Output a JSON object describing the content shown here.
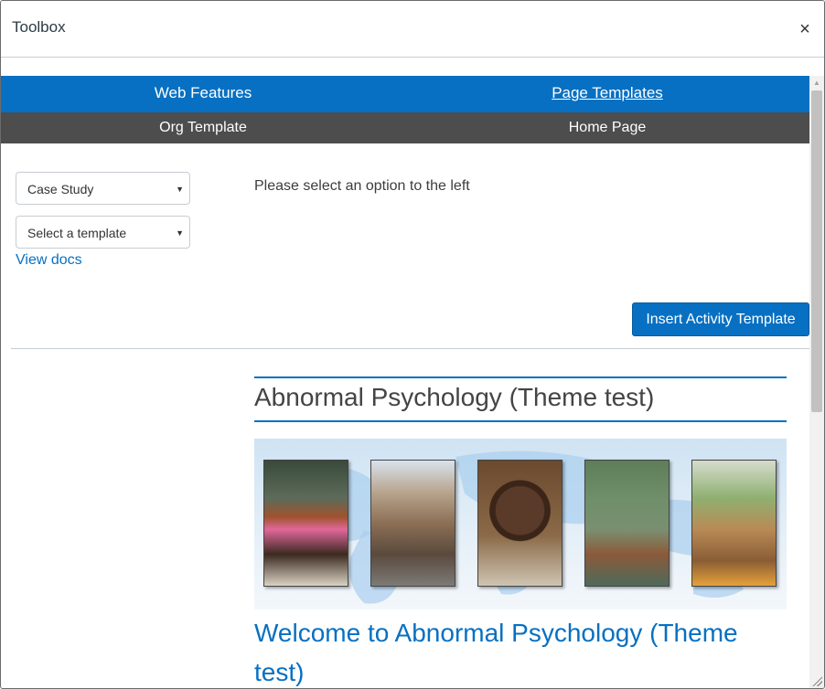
{
  "dialog": {
    "title": "Toolbox",
    "close_glyph": "×"
  },
  "nav_primary": {
    "items": [
      "Web Features",
      "Page Templates"
    ],
    "active_index": 1
  },
  "nav_secondary": {
    "items": [
      "Org Template",
      "Home Page"
    ]
  },
  "form": {
    "category_select": {
      "value": "Case Study",
      "arrow": "▼"
    },
    "template_select": {
      "value": "Select a template",
      "arrow": "▼"
    },
    "docs_link": "View docs",
    "prompt": "Please select an option to the left",
    "insert_button": "Insert Activity Template"
  },
  "preview": {
    "heading": "Abnormal Psychology (Theme test)",
    "welcome": "Welcome to Abnormal Psychology (Theme test)",
    "banner_photos": [
      "market-vendor-photo",
      "city-street-photo",
      "smiling-man-photo",
      "floating-market-photo",
      "produce-seller-photo"
    ]
  },
  "scrollbar": {
    "up_glyph": "▲"
  },
  "colors": {
    "primary_blue": "#0770c2",
    "secondary_gray": "#4d4d4d"
  }
}
